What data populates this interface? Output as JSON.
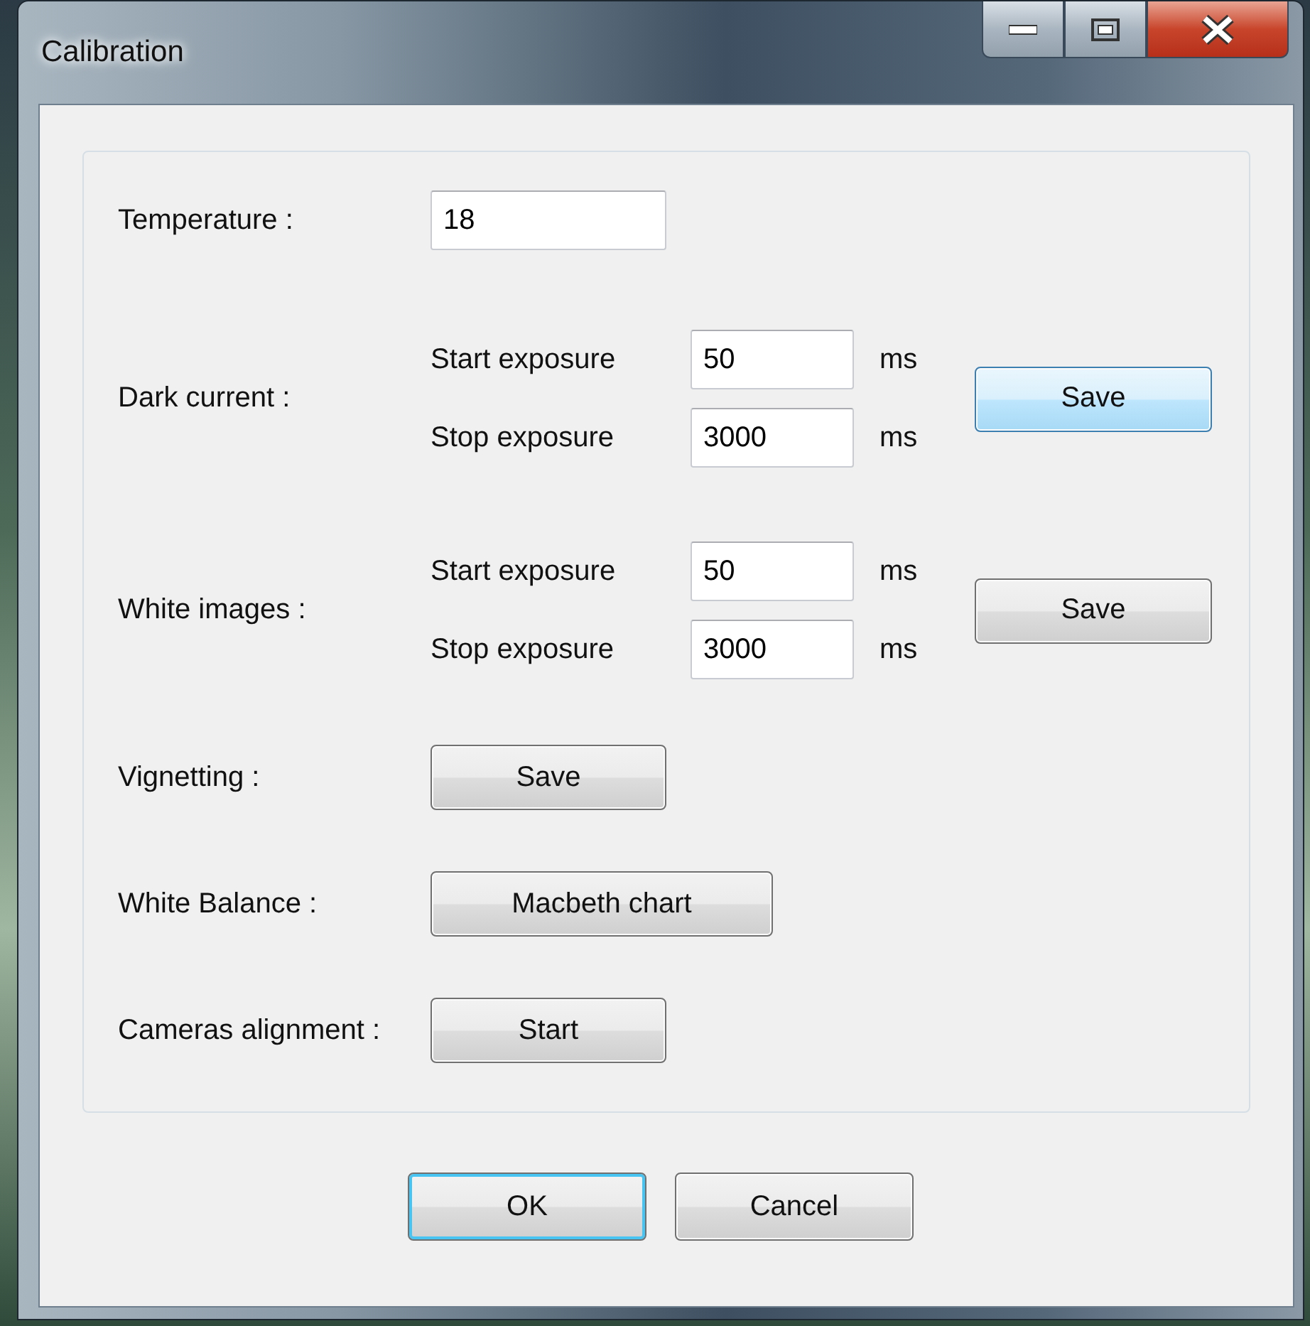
{
  "window": {
    "title": "Calibration",
    "controls": [
      {
        "kind": "minimize"
      },
      {
        "kind": "maximize"
      },
      {
        "kind": "close"
      }
    ]
  },
  "temperature": {
    "label": "Temperature :",
    "value": "18"
  },
  "exposure_groups": [
    {
      "label": "Dark current :",
      "start_label": "Start exposure",
      "start_value": "50",
      "start_unit": "ms",
      "stop_label": "Stop exposure",
      "stop_value": "3000",
      "stop_unit": "ms",
      "save": {
        "label": "Save",
        "hovered": true
      }
    },
    {
      "label": "White images :",
      "start_label": "Start exposure",
      "start_value": "50",
      "start_unit": "ms",
      "stop_label": "Stop exposure",
      "stop_value": "3000",
      "stop_unit": "ms",
      "save": {
        "label": "Save",
        "hovered": false
      }
    }
  ],
  "actions": [
    {
      "label": "Vignetting :",
      "button": "Save",
      "wide": false
    },
    {
      "label": "White Balance :",
      "button": "Macbeth chart",
      "wide": true
    },
    {
      "label": "Cameras alignment :",
      "button": "Start",
      "wide": false
    }
  ],
  "buttons": [
    {
      "label": "OK",
      "default": true
    },
    {
      "label": "Cancel",
      "default": false
    }
  ]
}
